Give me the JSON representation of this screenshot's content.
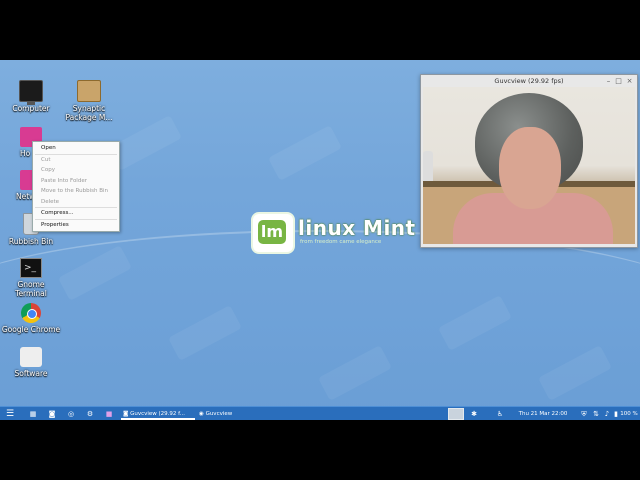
{
  "desktop": {
    "icons": [
      {
        "label": "Computer",
        "icon": "monitor-icon"
      },
      {
        "label": "Synaptic Package M...",
        "icon": "package-icon"
      },
      {
        "label": "Ho",
        "icon": "home-folder-icon"
      },
      {
        "label": "Netw",
        "icon": "network-icon"
      },
      {
        "label": "Rubbish Bin",
        "icon": "trash-icon"
      },
      {
        "label": "Gnome Terminal",
        "icon": "terminal-icon"
      },
      {
        "label": "Google Chrome",
        "icon": "chrome-icon"
      },
      {
        "label": "Software",
        "icon": "software-icon"
      }
    ]
  },
  "context_menu": {
    "items": [
      {
        "label": "Open",
        "enabled": true
      },
      {
        "label": "Cut",
        "enabled": false
      },
      {
        "label": "Copy",
        "enabled": false
      },
      {
        "label": "Paste Into Folder",
        "enabled": false
      },
      {
        "label": "Move to the Rubbish Bin",
        "enabled": false
      },
      {
        "label": "Delete",
        "enabled": false
      },
      {
        "label": "Compress...",
        "enabled": true
      },
      {
        "label": "Properties",
        "enabled": true
      }
    ]
  },
  "logo": {
    "title": "linux Mint",
    "subtitle": "from freedom came elegance"
  },
  "window": {
    "title": "Guvcview  (29.92 fps)",
    "buttons": {
      "minimize": "–",
      "maximize": "□",
      "close": "×"
    }
  },
  "taskbar": {
    "tasks": [
      {
        "label": "Guvcview  (29.92 f...",
        "icon": "camera-icon",
        "active": true
      },
      {
        "label": "Guvcview",
        "icon": "guvcview-icon",
        "active": false
      }
    ],
    "launchers": [
      "menu-icon",
      "grid-icon",
      "camera-icon",
      "lifebuoy-icon",
      "gear-icon",
      "folder-icon"
    ],
    "clock": "Thu 21 Mar  22:00",
    "battery": "100 %",
    "colors": {
      "panel": "#2a6ebc",
      "desktop": "#74a6da"
    }
  }
}
